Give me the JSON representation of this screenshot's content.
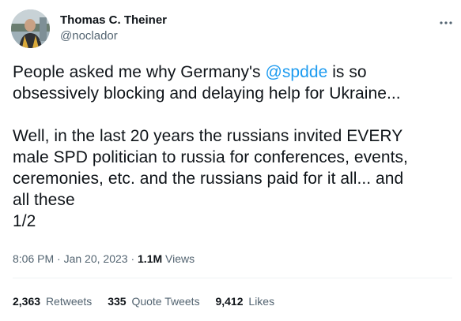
{
  "author": {
    "display_name": "Thomas C. Theiner",
    "handle": "@noclador"
  },
  "tweet": {
    "line1_prefix": "People asked me why Germany's ",
    "line1_mention": "@spdde",
    "line1_suffix": " is so",
    "line2": "obsessively blocking and delaying help for Ukraine...",
    "line3": "Well, in the last 20 years the russians invited EVERY",
    "line4": "male SPD politician to russia for conferences, events,",
    "line5": "ceremonies, etc. and the russians paid for it all... and",
    "line6": "all these",
    "line7": "1/2"
  },
  "meta": {
    "time": "8:06 PM",
    "separator1": " · ",
    "date": "Jan 20, 2023",
    "separator2": " · ",
    "views_count": "1.1M",
    "views_label": "Views"
  },
  "stats": {
    "retweets_count": "2,363",
    "retweets_label": "Retweets",
    "quotes_count": "335",
    "quotes_label": "Quote Tweets",
    "likes_count": "9,412",
    "likes_label": "Likes"
  },
  "icons": {
    "more": "more-horizontal-icon",
    "avatar": "profile-photo"
  },
  "colors": {
    "mention": "#1d9bf0",
    "text": "#0f1419",
    "secondary": "#536471"
  }
}
